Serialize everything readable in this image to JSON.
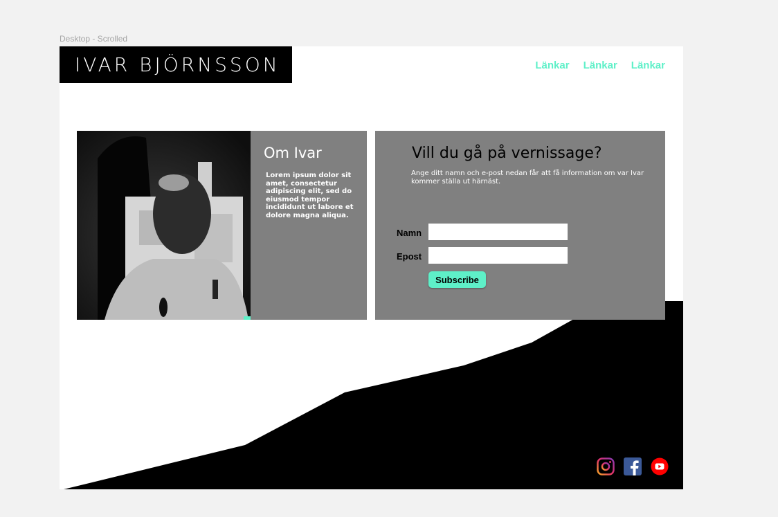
{
  "frame": {
    "label": "Desktop - Scrolled"
  },
  "header": {
    "logo": "IVAR BJÖRNSSON",
    "nav": [
      "Länkar",
      "Länkar",
      "Länkar"
    ]
  },
  "about": {
    "title": "Om Ivar",
    "text": "Lorem ipsum dolor sit amet, consectetur adipiscing elit, sed do eiusmod tempor incididunt ut labore et dolore magna aliqua."
  },
  "vernissage": {
    "title": "Vill du gå på vernissage?",
    "text": "Ange ditt namn och e-post nedan får att få information om var Ivar kommer ställa ut härnäst.",
    "name_label": "Namn",
    "email_label": "Epost",
    "name_value": "",
    "email_value": "",
    "subscribe_label": "Subscribe"
  },
  "social": [
    "instagram-icon",
    "facebook-icon",
    "youtube-icon"
  ],
  "colors": {
    "accent": "#5ef0c8",
    "card": "#808080",
    "dark": "#000000"
  }
}
